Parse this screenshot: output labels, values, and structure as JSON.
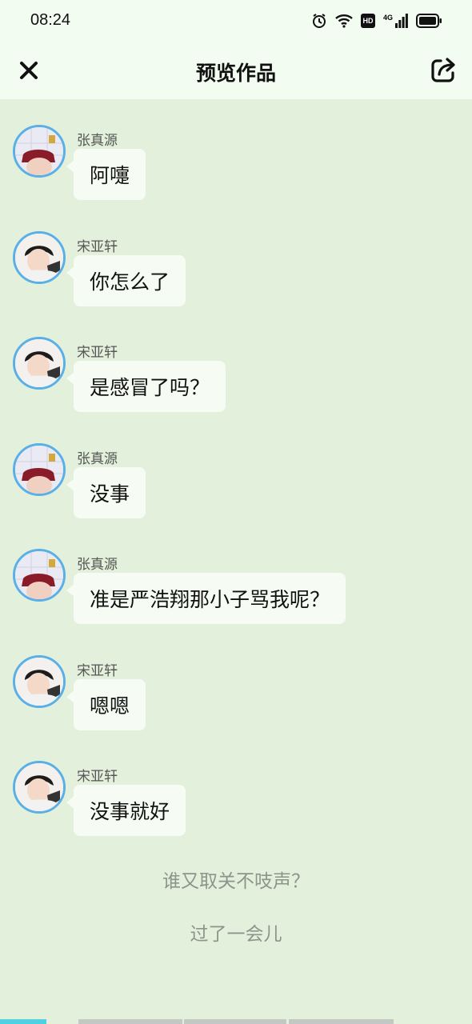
{
  "status": {
    "time": "08:24",
    "icons": [
      "alarm-icon",
      "wifi-icon",
      "hd-icon",
      "signal-4g-icon",
      "battery-icon"
    ],
    "network_label": "4G",
    "hd_label": "HD"
  },
  "header": {
    "title": "预览作品",
    "close_icon": "close-icon",
    "share_icon": "share-icon"
  },
  "messages": [
    {
      "sender": "张真源",
      "text": "阿嚏",
      "avatar": "avatar-zhang"
    },
    {
      "sender": "宋亚轩",
      "text": "你怎么了",
      "avatar": "avatar-song"
    },
    {
      "sender": "宋亚轩",
      "text": "是感冒了吗？",
      "avatar": "avatar-song"
    },
    {
      "sender": "张真源",
      "text": "没事",
      "avatar": "avatar-zhang"
    },
    {
      "sender": "张真源",
      "text": "准是严浩翔那小子骂我呢？",
      "avatar": "avatar-zhang"
    },
    {
      "sender": "宋亚轩",
      "text": "嗯嗯",
      "avatar": "avatar-song"
    },
    {
      "sender": "宋亚轩",
      "text": "没事就好",
      "avatar": "avatar-song"
    }
  ],
  "narrations": [
    "谁又取关不吱声？",
    "过了一会儿"
  ],
  "progress": {
    "segments": 4,
    "active_index": 0
  },
  "colors": {
    "background": "#e3f1dc",
    "header": "#f3fcf1",
    "bubble": "#f6fcf3",
    "avatar_border": "#5ab0e6",
    "progress_active": "#4fd0e3",
    "progress_inactive": "#c3c8c2"
  }
}
